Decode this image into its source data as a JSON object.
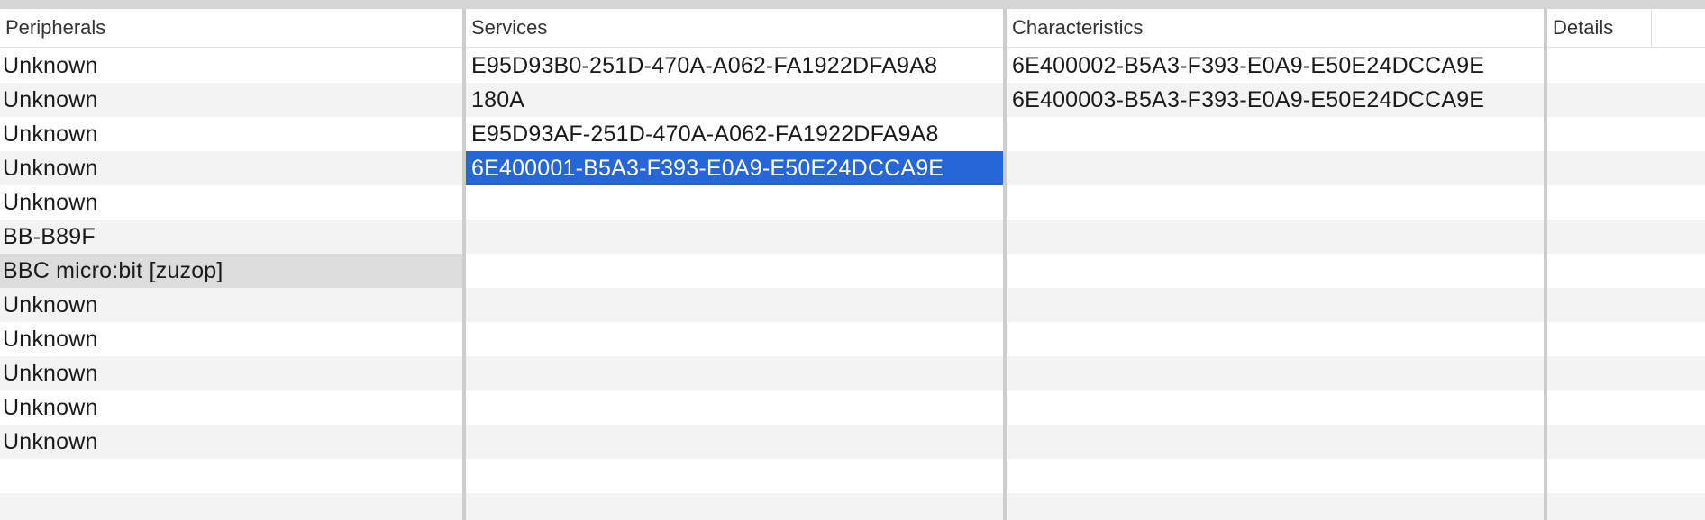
{
  "columns": {
    "peripherals": "Peripherals",
    "services": "Services",
    "characteristics": "Characteristics",
    "details": "Details"
  },
  "peripherals": [
    "Unknown",
    "Unknown",
    "Unknown",
    "Unknown",
    "Unknown",
    "BB-B89F",
    "BBC micro:bit [zuzop]",
    "Unknown",
    "Unknown",
    "Unknown",
    "Unknown",
    "Unknown",
    "",
    ""
  ],
  "peripherals_hover_index": 6,
  "services": [
    "E95D93B0-251D-470A-A062-FA1922DFA9A8",
    "180A",
    "E95D93AF-251D-470A-A062-FA1922DFA9A8",
    "6E400001-B5A3-F393-E0A9-E50E24DCCA9E",
    "",
    "",
    "",
    "",
    "",
    "",
    "",
    "",
    "",
    ""
  ],
  "services_selected_index": 3,
  "characteristics": [
    "6E400002-B5A3-F393-E0A9-E50E24DCCA9E",
    "6E400003-B5A3-F393-E0A9-E50E24DCCA9E",
    "",
    "",
    "",
    "",
    "",
    "",
    "",
    "",
    "",
    "",
    "",
    ""
  ],
  "details": [
    "",
    "",
    "",
    "",
    "",
    "",
    "",
    "",
    "",
    "",
    "",
    "",
    "",
    ""
  ],
  "colors": {
    "selection": "#2666d6",
    "hover_row": "#dcdcdc",
    "stripe": "#f3f3f3"
  },
  "watermark_icon": "bluetooth-app-logo-watermark"
}
